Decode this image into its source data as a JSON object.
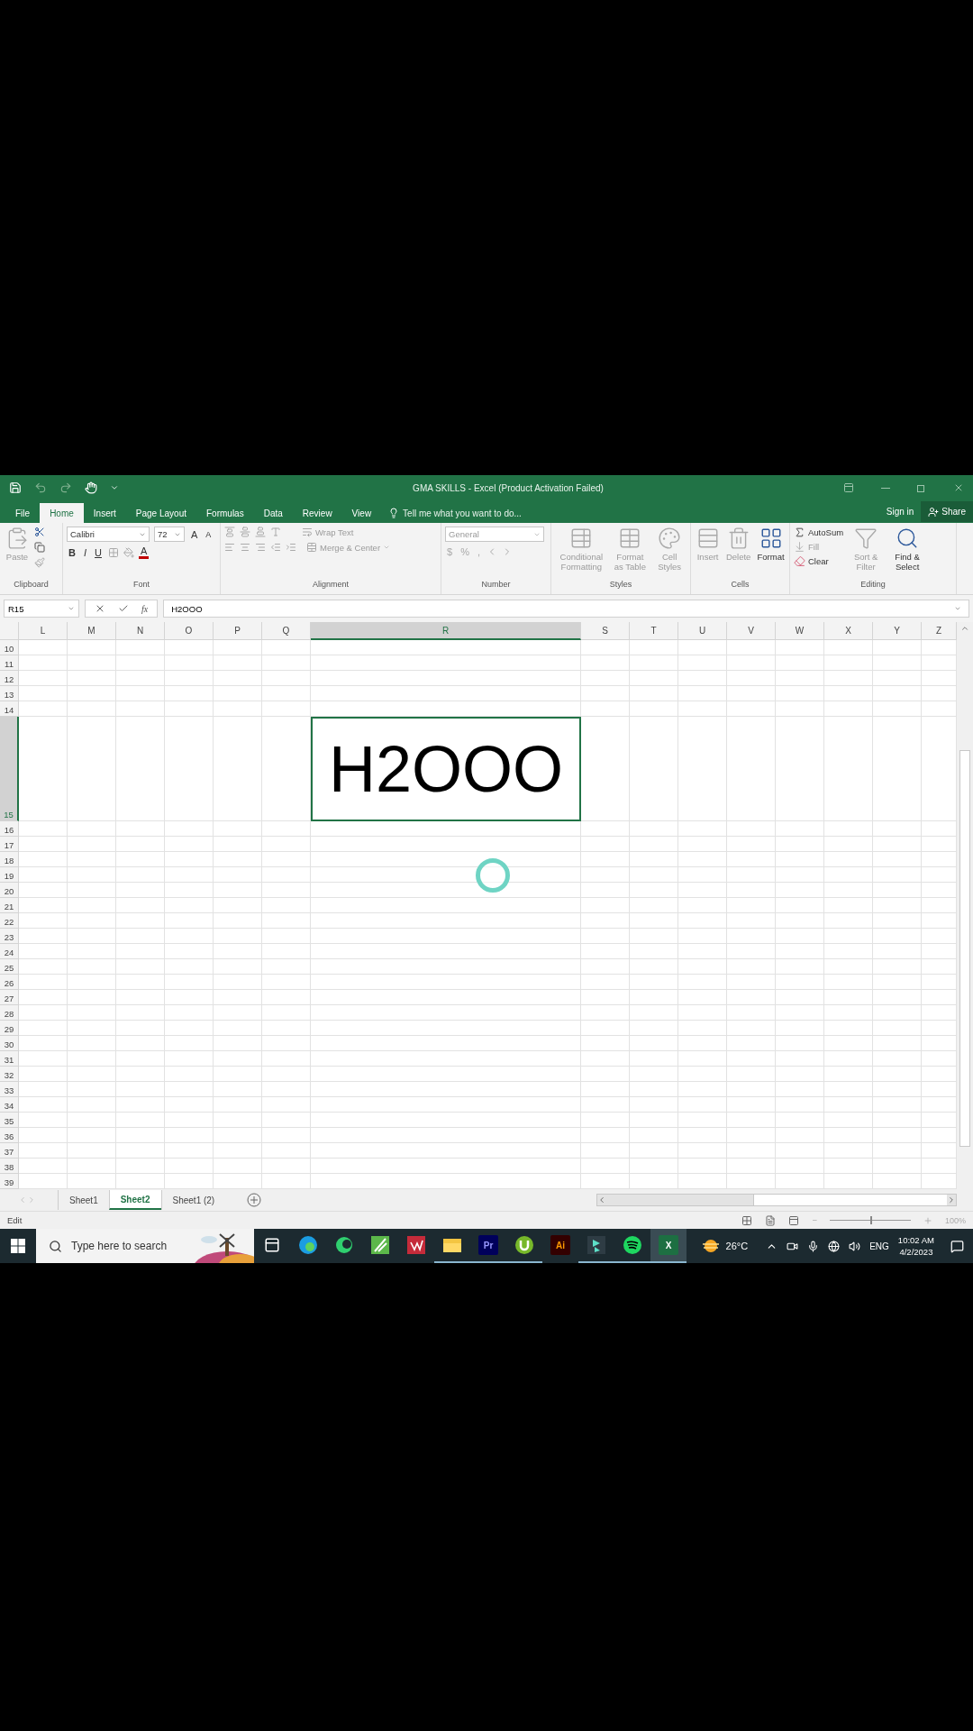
{
  "title_bar": {
    "title": "GMA SKILLS - Excel (Product Activation Failed)"
  },
  "quick_access": [
    {
      "kind": "save",
      "disabled": false
    },
    {
      "kind": "undo",
      "disabled": true
    },
    {
      "kind": "redo",
      "disabled": true
    },
    {
      "kind": "touch_mode",
      "disabled": false
    },
    {
      "kind": "customize",
      "disabled": false
    }
  ],
  "menu_tabs": [
    {
      "label": "File",
      "selected": false
    },
    {
      "label": "Home",
      "selected": true
    },
    {
      "label": "Insert",
      "selected": false
    },
    {
      "label": "Page Layout",
      "selected": false
    },
    {
      "label": "Formulas",
      "selected": false
    },
    {
      "label": "Data",
      "selected": false
    },
    {
      "label": "Review",
      "selected": false
    },
    {
      "label": "View",
      "selected": false
    }
  ],
  "tell_me": {
    "placeholder": "Tell me what you want to do..."
  },
  "account": {
    "sign_in": "Sign in",
    "share": "Share"
  },
  "ribbon": {
    "clipboard": {
      "label": "Clipboard",
      "paste": {
        "label": "Paste",
        "disabled": true
      }
    },
    "font": {
      "label": "Font",
      "font_name": "Calibri",
      "font_size": "72",
      "grow": "A",
      "shrink": "A",
      "bold": "B",
      "italic": "I",
      "underline": "U",
      "font_color": "A"
    },
    "alignment": {
      "label": "Alignment",
      "wrap_text": {
        "label": "Wrap Text",
        "disabled": true
      },
      "merge_center": {
        "label": "Merge & Center",
        "disabled": true
      }
    },
    "number": {
      "label": "Number",
      "format": "General",
      "currency": "$",
      "percent": "%",
      "comma": ","
    },
    "styles": {
      "label": "Styles",
      "buttons": [
        {
          "kind": "conditional",
          "label": "Conditional Formatting",
          "disabled": true
        },
        {
          "kind": "table",
          "label": "Format as Table",
          "disabled": true
        },
        {
          "kind": "cell_styles",
          "label": "Cell Styles",
          "disabled": true
        }
      ]
    },
    "cells": {
      "label": "Cells",
      "buttons": [
        {
          "kind": "insert",
          "label": "Insert",
          "disabled": true
        },
        {
          "kind": "delete",
          "label": "Delete",
          "disabled": true
        },
        {
          "kind": "format",
          "label": "Format",
          "disabled": false
        }
      ]
    },
    "editing": {
      "label": "Editing",
      "small": [
        {
          "kind": "autosum",
          "label": "AutoSum",
          "disabled": false
        },
        {
          "kind": "fill",
          "label": "Fill",
          "disabled": true
        },
        {
          "kind": "clear",
          "label": "Clear",
          "disabled": false
        }
      ],
      "buttons": [
        {
          "kind": "sort",
          "label": "Sort & Filter",
          "disabled": true
        },
        {
          "kind": "find",
          "label": "Find & Select",
          "disabled": false
        }
      ]
    }
  },
  "formula_bar": {
    "name_box": "R15",
    "fx": "fx",
    "value": "H2OOO"
  },
  "columns": [
    {
      "label": "L",
      "selected": false
    },
    {
      "label": "M",
      "selected": false
    },
    {
      "label": "N",
      "selected": false
    },
    {
      "label": "O",
      "selected": false
    },
    {
      "label": "P",
      "selected": false
    },
    {
      "label": "Q",
      "selected": false
    },
    {
      "label": "R",
      "selected": true
    },
    {
      "label": "S",
      "selected": false
    },
    {
      "label": "T",
      "selected": false
    },
    {
      "label": "U",
      "selected": false
    },
    {
      "label": "V",
      "selected": false
    },
    {
      "label": "W",
      "selected": false
    },
    {
      "label": "X",
      "selected": false
    },
    {
      "label": "Y",
      "selected": false
    },
    {
      "label": "Z",
      "selected": false
    }
  ],
  "rows": [
    {
      "label": "10",
      "kind": "normal",
      "selected": false
    },
    {
      "label": "11",
      "kind": "normal",
      "selected": false
    },
    {
      "label": "12",
      "kind": "normal",
      "selected": false
    },
    {
      "label": "13",
      "kind": "normal",
      "selected": false
    },
    {
      "label": "14",
      "kind": "normal",
      "selected": false
    },
    {
      "label": "15",
      "kind": "tall",
      "selected": true
    },
    {
      "label": "16",
      "kind": "normal",
      "selected": false
    },
    {
      "label": "17",
      "kind": "normal",
      "selected": false
    },
    {
      "label": "18",
      "kind": "normal",
      "selected": false
    },
    {
      "label": "19",
      "kind": "normal",
      "selected": false
    },
    {
      "label": "20",
      "kind": "normal",
      "selected": false
    },
    {
      "label": "21",
      "kind": "normal",
      "selected": false
    },
    {
      "label": "22",
      "kind": "normal",
      "selected": false
    },
    {
      "label": "23",
      "kind": "normal",
      "selected": false
    },
    {
      "label": "24",
      "kind": "normal",
      "selected": false
    },
    {
      "label": "25",
      "kind": "normal",
      "selected": false
    },
    {
      "label": "26",
      "kind": "normal",
      "selected": false
    },
    {
      "label": "27",
      "kind": "normal",
      "selected": false
    },
    {
      "label": "28",
      "kind": "normal",
      "selected": false
    },
    {
      "label": "29",
      "kind": "normal",
      "selected": false
    },
    {
      "label": "30",
      "kind": "normal",
      "selected": false
    },
    {
      "label": "31",
      "kind": "normal",
      "selected": false
    },
    {
      "label": "32",
      "kind": "normal",
      "selected": false
    },
    {
      "label": "33",
      "kind": "normal",
      "selected": false
    },
    {
      "label": "34",
      "kind": "normal",
      "selected": false
    },
    {
      "label": "35",
      "kind": "normal",
      "selected": false
    },
    {
      "label": "36",
      "kind": "normal",
      "selected": false
    },
    {
      "label": "37",
      "kind": "normal",
      "selected": false
    },
    {
      "label": "38",
      "kind": "normal",
      "selected": false
    },
    {
      "label": "39",
      "kind": "normal",
      "selected": false
    }
  ],
  "active_cell_value": "H2OOO",
  "sheet_tabs": [
    {
      "label": "Sheet1",
      "selected": false
    },
    {
      "label": "Sheet2",
      "selected": true
    },
    {
      "label": "Sheet1 (2)",
      "selected": false
    }
  ],
  "status_bar": {
    "mode": "Edit",
    "zoom_out": "−",
    "zoom_slider": {
      "level": 0.5
    },
    "zoom": "100%"
  },
  "taskbar": {
    "search_placeholder": "Type here to search",
    "apps": [
      {
        "kind": "task_view",
        "running": false,
        "selected": false
      },
      {
        "kind": "edge",
        "running": false,
        "selected": false
      },
      {
        "kind": "green_circle",
        "running": false,
        "selected": false
      },
      {
        "kind": "green_square",
        "running": false,
        "selected": false
      },
      {
        "kind": "red_square",
        "running": false,
        "selected": false
      },
      {
        "kind": "folder",
        "running": true,
        "selected": false
      },
      {
        "kind": "premiere",
        "label": "Pr",
        "running": true,
        "selected": false
      },
      {
        "kind": "utorrent",
        "running": true,
        "selected": false
      },
      {
        "kind": "illustrator",
        "label": "Ai",
        "running": false,
        "selected": false
      },
      {
        "kind": "filmora",
        "running": true,
        "selected": false
      },
      {
        "kind": "spotify",
        "running": true,
        "selected": false
      },
      {
        "kind": "excel",
        "label": "X",
        "running": true,
        "selected": true
      }
    ],
    "weather": "26°C",
    "language": "ENG",
    "time": "10:02 AM",
    "date": "4/2/2023"
  }
}
